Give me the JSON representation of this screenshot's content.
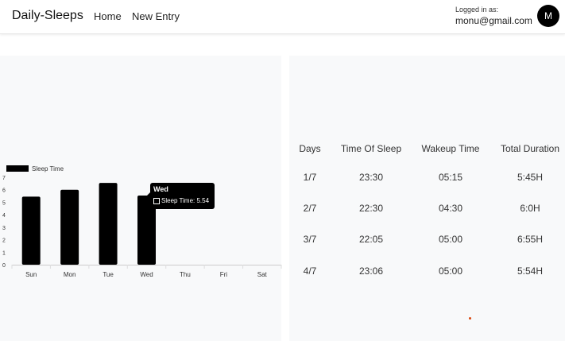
{
  "navbar": {
    "brand": "Daily-Sleeps",
    "home_label": "Home",
    "new_entry_label": "New Entry",
    "logged_in_label": "Logged in as:",
    "user_email": "monu@gmail.com",
    "avatar_letter": "M"
  },
  "chart_data": {
    "type": "bar",
    "categories": [
      "Sun",
      "Mon",
      "Tue",
      "Wed",
      "Thu",
      "Fri",
      "Sat"
    ],
    "series": [
      {
        "name": "Sleep Time",
        "values": [
          5.45,
          6.0,
          6.55,
          5.54,
          null,
          null,
          null
        ]
      }
    ],
    "y_ticks": [
      "0",
      "1",
      "2",
      "3",
      "4",
      "5",
      "6",
      "7"
    ],
    "ylim": [
      0,
      7
    ],
    "legend_position": "top-left",
    "bar_color": "#000000",
    "tooltip": {
      "title": "Wed",
      "label": "Sleep Time: 5.54"
    }
  },
  "table": {
    "headers": [
      "Days",
      "Time Of Sleep",
      "Wakeup Time",
      "Total Duration"
    ],
    "rows": [
      [
        "1/7",
        "23:30",
        "05:15",
        "5:45H"
      ],
      [
        "2/7",
        "22:30",
        "04:30",
        "6:0H"
      ],
      [
        "3/7",
        "22:05",
        "05:00",
        "6:55H"
      ],
      [
        "4/7",
        "23:06",
        "05:00",
        "5:54H"
      ]
    ]
  }
}
